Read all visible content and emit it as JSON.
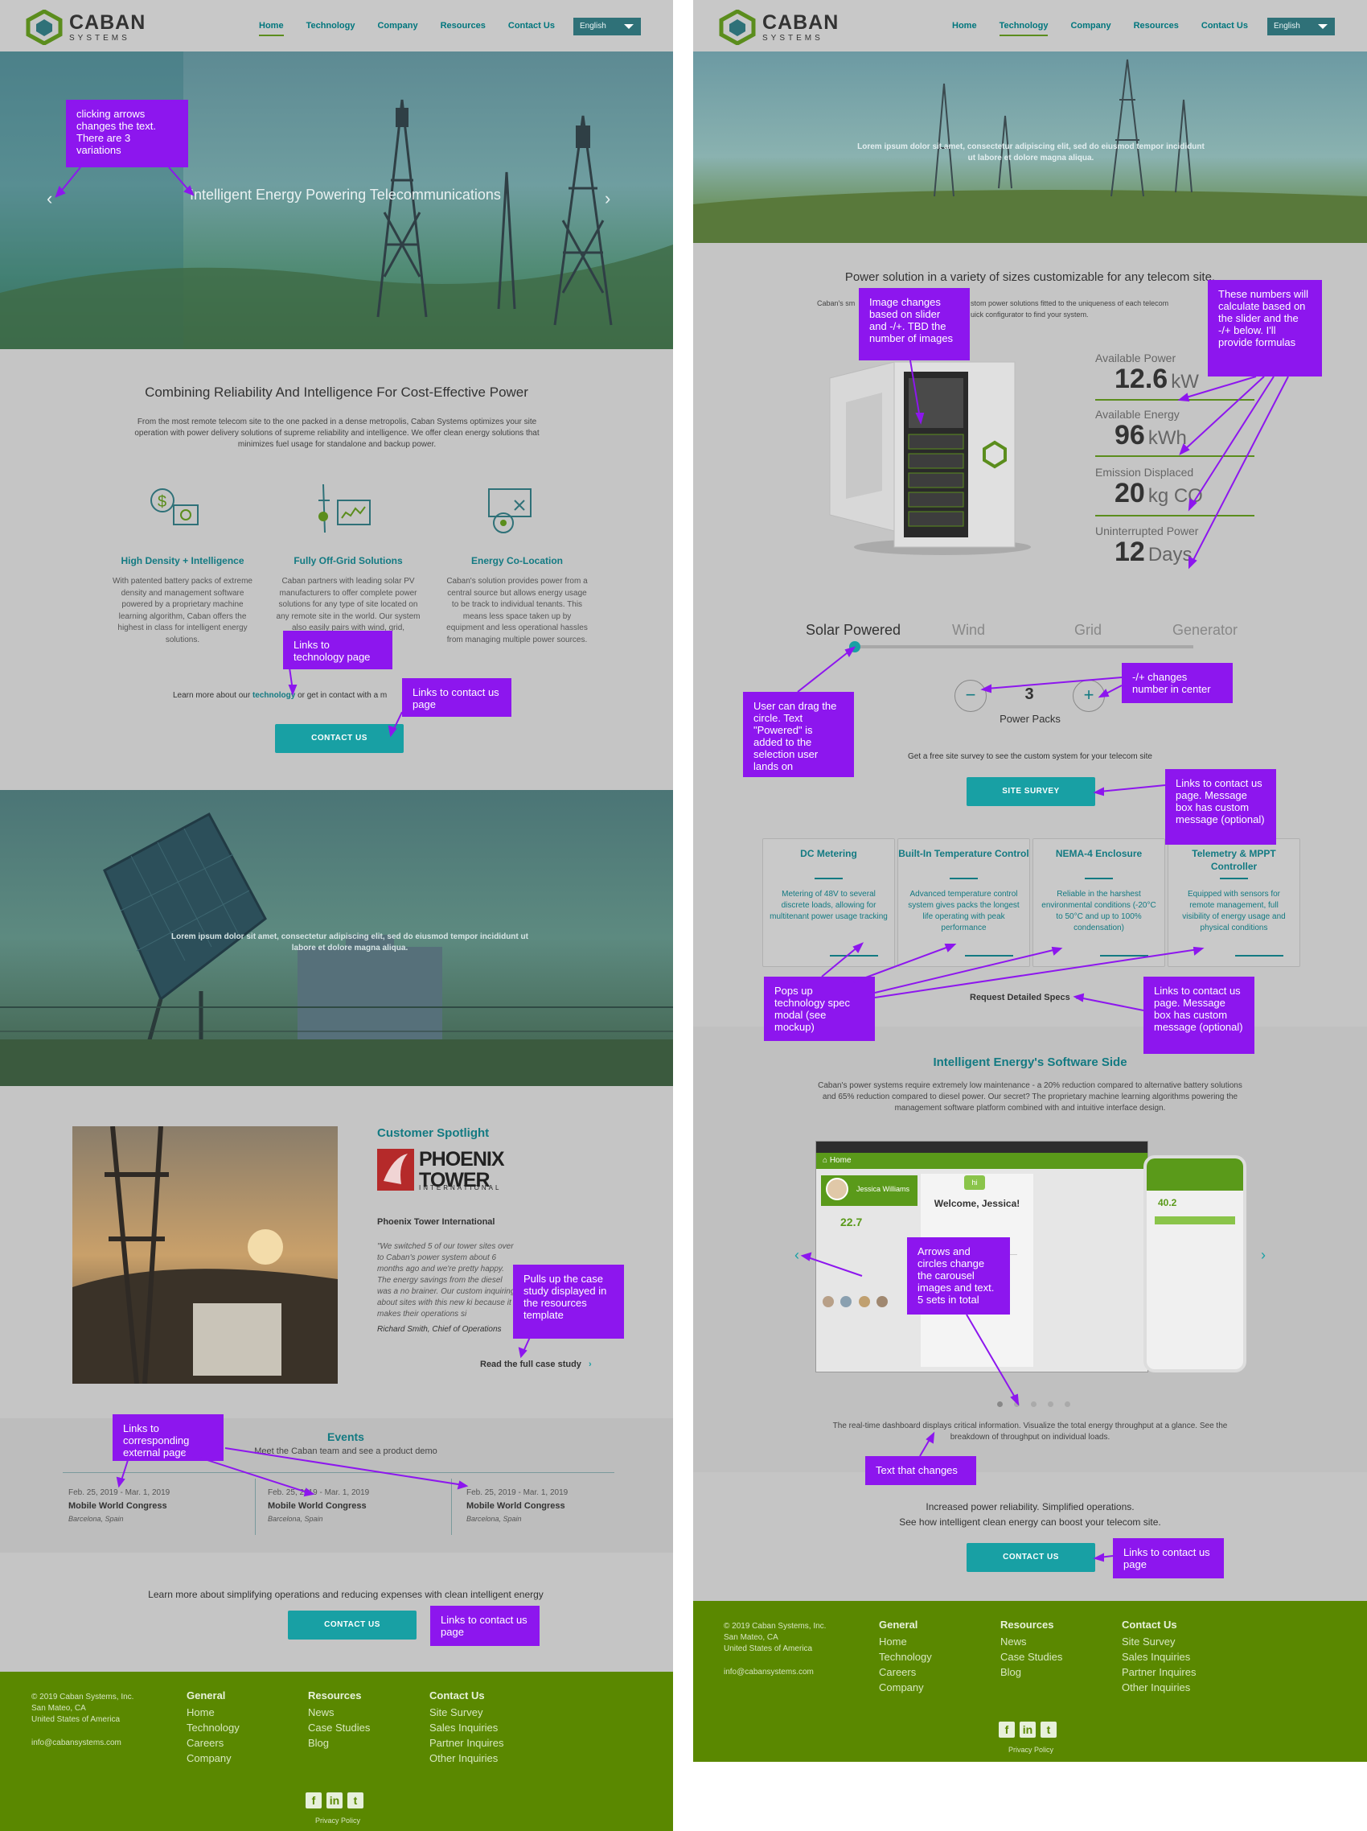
{
  "brand": {
    "name": "CABAN",
    "sub": "SYSTEMS"
  },
  "nav": {
    "items": [
      "Home",
      "Technology",
      "Company",
      "Resources",
      "Contact Us"
    ],
    "language": "English"
  },
  "colors": {
    "accent": "#18a0a4",
    "brand_green": "#5a8800",
    "annotation": "#8d16ee"
  },
  "left": {
    "hero_text": "Intelligent Energy Powering Telecommunications",
    "note_arrows": "clicking arrows changes the text. There are 3 variations",
    "intro_title": "Combining Reliability And Intelligence For Cost-Effective Power",
    "intro_body": "From the most remote telecom site to the one packed in a dense metropolis, Caban Systems optimizes your site operation with power delivery solutions of supreme reliability and intelligence. We offer clean energy solutions that minimizes fuel usage for standalone and backup power.",
    "features": [
      {
        "title": "High Density + Intelligence",
        "body": "With patented battery packs of extreme density and management software powered by a proprietary machine learning algorithm, Caban offers the highest in class for intelligent energy solutions."
      },
      {
        "title": "Fully Off-Grid Solutions",
        "body": "Caban partners with leading solar PV manufacturers to offer complete power solutions for any type of site located on any remote site in the world. Our system also easily pairs with wind, grid,"
      },
      {
        "title": "Energy Co-Location",
        "body": "Caban's solution provides power from a central source but allows energy usage to be track to individual tenants. This means less space taken up by equipment and less operational hassles from managing multiple power sources."
      }
    ],
    "note_tech": "Links to technology page",
    "learn_prefix": "Learn more about our",
    "learn_link": "technology",
    "learn_suffix": "or get in contact with a m",
    "note_contact1": "Links to contact us page",
    "contact_btn": "CONTACT US",
    "mid_banner_text": "Lorem ipsum dolor sit amet, consectetur adipiscing elit, sed do eiusmod tempor incididunt ut labore et dolore magna aliqua.",
    "spotlight": {
      "heading": "Customer Spotlight",
      "logo_main": "PHOENIX TOWER",
      "logo_sub": "INTERNATIONAL",
      "company": "Phoenix Tower International",
      "quote": "\"We switched 5 of our tower sites over to Caban's power system about 6 months ago and we're pretty happy. The energy savings from the diesel was a no brainer. Our custom inquiring about sites with this new ki because it makes their operations si",
      "author": "Richard Smith, Chief of Operations",
      "read_more": "Read the full case study",
      "note": "Pulls up the case study displayed in the resources template"
    },
    "events": {
      "title": "Events",
      "subtitle": "Meet the Caban team and see a product demo",
      "note": "Links to corresponding external page",
      "items": [
        {
          "date": "Feb. 25, 2019 - Mar. 1, 2019",
          "name": "Mobile World Congress",
          "loc": "Barcelona, Spain"
        },
        {
          "date": "Feb. 25, 2019 - Mar. 1, 2019",
          "name": "Mobile World Congress",
          "loc": "Barcelona, Spain"
        },
        {
          "date": "Feb. 25, 2019 - Mar. 1, 2019",
          "name": "Mobile World Congress",
          "loc": "Barcelona, Spain"
        }
      ]
    },
    "cta_text": "Learn more about simplifying operations and reducing expenses with clean intelligent energy",
    "cta_btn": "CONTACT US",
    "note_contact2": "Links to contact us page"
  },
  "right": {
    "hero_text": "Lorem ipsum dolor sit amet, consectetur adipiscing elit, sed do eiusmod tempor incididunt ut labore et dolore magna aliqua.",
    "sizes_title": "Power solution in a variety of sizes customizable for any telecom site.",
    "sizes_body_left": "Caban's sm",
    "sizes_body_mid": "stom power solutions fitted to the uniqueness of each telecom",
    "sizes_body_mid2": "uick configurator to find your system.",
    "note_image": "Image changes based on slider and -/+. TBD the number of images",
    "note_numbers": "These numbers will calculate based on the slider and the -/+ below. I'll provide formulas",
    "metrics": [
      {
        "label": "Available Power",
        "value": "12.6",
        "unit": "kW"
      },
      {
        "label": "Available Energy",
        "value": "96",
        "unit": "kWh"
      },
      {
        "label": "Emission Displaced",
        "value": "20",
        "unit": "kg CO"
      },
      {
        "label": "Uninterrupted Power",
        "value": "12",
        "unit": "Days"
      }
    ],
    "sources": [
      "Solar Powered",
      "Wind",
      "Grid",
      "Generator"
    ],
    "packs_value": "3",
    "packs_label": "Power Packs",
    "note_drag": "User can drag the circle. Text \"Powered\" is added to the selection user lands on",
    "note_plusminus": "-/+ changes number in center",
    "survey_text": "Get a free site survey to see the custom system for your telecom site",
    "survey_btn": "SITE SURVEY",
    "note_survey": "Links to contact us page. Message box has custom message (optional)",
    "specs": [
      {
        "title": "DC Metering",
        "body": "Metering of 48V to several discrete loads, allowing for multitenant power usage tracking"
      },
      {
        "title": "Built-In Temperature Control",
        "body": "Advanced temperature control system gives packs the longest life operating with peak performance"
      },
      {
        "title": "NEMA-4 Enclosure",
        "body": "Reliable in the harshest environmental conditions (-20°C to 50°C and up to 100% condensation)"
      },
      {
        "title": "Telemetry & MPPT Controller",
        "body": "Equipped with sensors for remote management, full visibility of energy usage and physical conditions"
      }
    ],
    "note_modal": "Pops up technology spec modal (see mockup)",
    "request_specs": "Request Detailed Specs",
    "note_specs": "Links to contact us page. Message box has custom message (optional)",
    "software_title": "Intelligent Energy's Software Side",
    "software_body": "Caban's power systems require extremely low maintenance - a 20% reduction compared to alternative battery solutions and 65% reduction compared to diesel power. Our secret? The proprietary machine learning algorithms powering the management software platform combined with and intuitive interface design.",
    "dash": {
      "home": "Home",
      "welcome": "Welcome, Jessica!",
      "user": "Jessica Williams",
      "stat": "22.7",
      "phone_stat": "40.2"
    },
    "note_carousel": "Arrows and circles change the carousel images and text. 5 sets in total",
    "carousel_caption": "The real-time dashboard displays critical information. Visualize the total energy throughput at a glance. See the breakdown of throughput on individual loads.",
    "note_caption": "Text that changes",
    "cta_line1": "Increased power reliability. Simplified operations.",
    "cta_line2": "See how intelligent clean energy can boost your telecom site.",
    "cta_btn": "CONTACT US",
    "note_cta": "Links to contact us page"
  },
  "footer": {
    "copyright": "© 2019 Caban Systems, Inc.",
    "city": "San Mateo, CA",
    "country": "United States of America",
    "email": "info@cabansystems.com",
    "general_h": "General",
    "general": [
      "Home",
      "Technology",
      "Careers",
      "Company"
    ],
    "resources_h": "Resources",
    "resources": [
      "News",
      "Case Studies",
      "Blog"
    ],
    "contact_h": "Contact Us",
    "contact": [
      "Site Survey",
      "Sales Inquiries",
      "Partner Inquires",
      "Other Inquiries"
    ],
    "privacy": "Privacy Policy"
  }
}
